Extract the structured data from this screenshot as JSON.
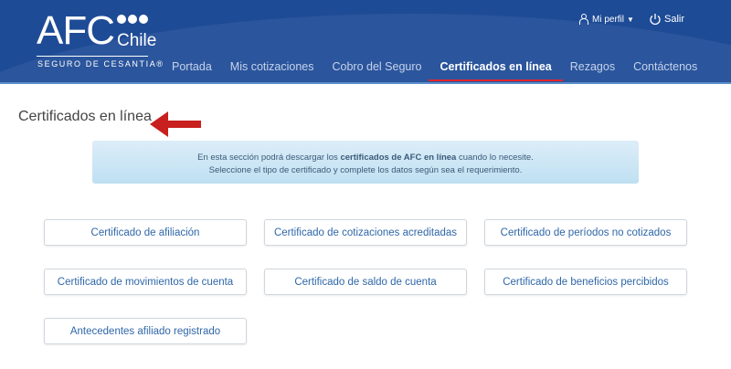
{
  "logo": {
    "brand": "AFC",
    "country": "Chile",
    "tagline": "SEGURO DE CESANTIA®"
  },
  "nav": [
    {
      "label": "Portada"
    },
    {
      "label": "Mis cotizaciones"
    },
    {
      "label": "Cobro del Seguro"
    },
    {
      "label": "Certificados en línea"
    },
    {
      "label": "Rezagos"
    },
    {
      "label": "Contáctenos"
    }
  ],
  "user": {
    "profile": "Mi perfil",
    "logout": "Salir"
  },
  "page_title": "Certificados en línea",
  "info": {
    "pre": "En esta sección podrá descargar los ",
    "bold": "certificados de AFC en línea",
    "post": " cuando lo necesite.",
    "line2": "Seleccione el tipo de certificado y complete los datos según sea el requerimiento."
  },
  "buttons": [
    {
      "label": "Certificado de afiliación"
    },
    {
      "label": "Certificado de cotizaciones acreditadas"
    },
    {
      "label": "Certificado de períodos no cotizados"
    },
    {
      "label": "Certificado de movimientos de cuenta"
    },
    {
      "label": "Certificado de saldo de cuenta"
    },
    {
      "label": "Certificado de beneficios percibidos"
    },
    {
      "label": "Antecedentes afiliado registrado"
    }
  ],
  "colors": {
    "header": "#1e4b96",
    "accent": "#e3232a",
    "link": "#2f67a8"
  }
}
